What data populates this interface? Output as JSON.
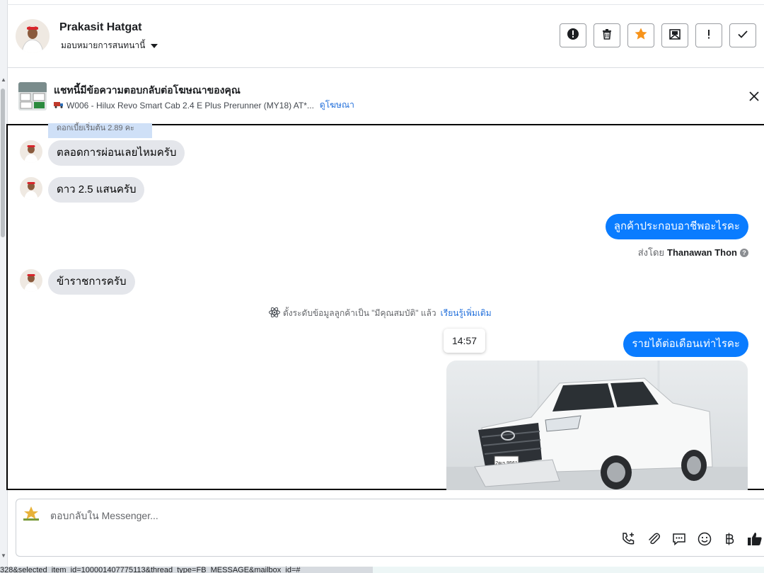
{
  "header": {
    "contact_name": "Prakasit Hatgat",
    "assign_label": "มอบหมายการสนทนานี้",
    "actions": [
      {
        "icon": "alert-circle-icon"
      },
      {
        "icon": "trash-icon"
      },
      {
        "icon": "star-icon",
        "color": "#f7931a"
      },
      {
        "icon": "mark-unread-icon"
      },
      {
        "icon": "exclamation-icon"
      },
      {
        "icon": "check-icon"
      }
    ]
  },
  "ad_banner": {
    "title": "แชทนี้มีข้อความตอบกลับต่อโฆษณาของคุณ",
    "ad_text": "W006 - Hilux Revo Smart Cab 2.4 E Plus Prerunner (MY18) AT*...",
    "ad_link": "ดูโฆษณา"
  },
  "chat": {
    "faded_text": "ดอกเบี้ยเริ่มต้น 2.89 คะ",
    "messages": [
      {
        "dir": "in",
        "text": "ตลอดการผ่อนเลยไหมครับ"
      },
      {
        "dir": "in",
        "text": "ดาว 2.5 แสนครับ"
      },
      {
        "dir": "out",
        "text": "ลูกค้าประกอบอาชีพอะไรคะ"
      },
      {
        "dir": "in",
        "text": "ข้าราชการครับ"
      },
      {
        "dir": "out",
        "text": "รายได้ต่อเดือนเท่าไรคะ"
      }
    ],
    "sent_by_prefix": "ส่งโดย",
    "sent_by_name": "Thanawan Thon",
    "system_note": "ตั้งระดับข้อมูลลูกค้าเป็น \"มีคุณสมบัติ\" แล้ว",
    "system_note_link": "เรียนรู้เพิ่มเติม",
    "time_tooltip": "14:57",
    "plate_text": "2ฒร 9561"
  },
  "composer": {
    "placeholder": "ตอบกลับใน Messenger...",
    "tools": [
      "phone-plus-icon",
      "paperclip-icon",
      "chat-bubble-icon",
      "emoji-icon",
      "baht-icon",
      "thumbs-up-icon"
    ]
  },
  "status_bar": {
    "url_fragment": "328&selected_item_id=100001407775113&thread_type=FB_MESSAGE&mailbox_id=#"
  },
  "colors": {
    "outgoing_bubble": "#0a7cff",
    "incoming_bubble": "#e4e6eb",
    "link": "#216fdb",
    "star": "#f7931a"
  }
}
